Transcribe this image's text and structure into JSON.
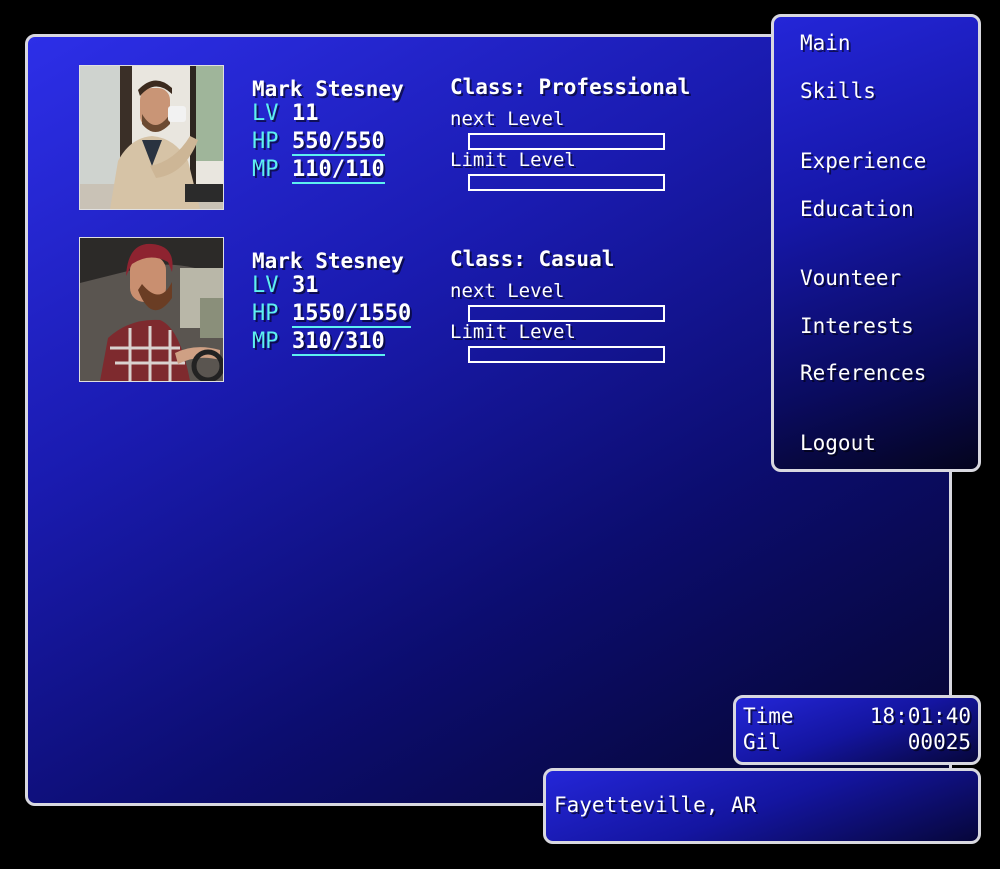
{
  "characters": [
    {
      "name": "Mark Stesney",
      "lv_label": "LV",
      "lv": "11",
      "hp_label": "HP",
      "hp": "550/550",
      "mp_label": "MP",
      "mp": "110/110",
      "class_line": "Class: Professional",
      "next_level_label": "next Level",
      "next_level_progress": 0,
      "limit_level_label": "Limit Level",
      "limit_level_progress": 0,
      "portrait_icon": "man-drinking-coffee-photo"
    },
    {
      "name": "Mark Stesney",
      "lv_label": "LV",
      "lv": "31",
      "hp_label": "HP",
      "hp": "1550/1550",
      "mp_label": "MP",
      "mp": "310/310",
      "class_line": "Class: Casual",
      "next_level_label": "next Level",
      "next_level_progress": 0,
      "limit_level_label": "Limit Level",
      "limit_level_progress": 0,
      "portrait_icon": "man-driving-car-photo"
    }
  ],
  "menu": {
    "items": [
      "Main",
      "Skills",
      "Experience",
      "Education",
      "Vounteer",
      "Interests",
      "References",
      "Logout"
    ]
  },
  "status": {
    "time_label": "Time",
    "time_value": "18:01:40",
    "gil_label": "Gil",
    "gil_value": "00025"
  },
  "location": "Fayetteville, AR",
  "colors": {
    "panel_top": "#2d2fe8",
    "panel_bottom": "#05052a",
    "border": "#d8d8e0",
    "stat_label": "#5ef0f0",
    "text": "#ffffff"
  }
}
